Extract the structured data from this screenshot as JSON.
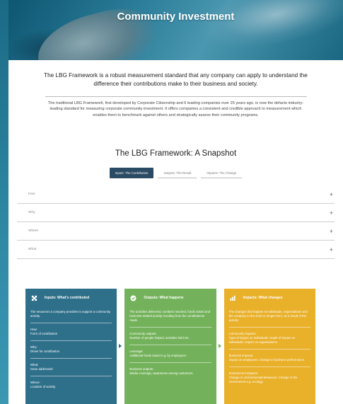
{
  "hero": {
    "title": "Community Investment"
  },
  "intro": {
    "lead": "The LBG Framework is a robust measurement standard that any company can apply to understand the difference their contributions make to their business and society.",
    "body": "The traditional LBG Framework, first developed by Corporate Citizenship and 6 leading companies over 25 years ago, is now the defacto industry-leading standard for measuring corporate community investment. It offers companies a consistent and credible approach to measurement which enables them to benchmark against others and strategically assess their community programs."
  },
  "snapshot": {
    "title": "The LBG Framework: A Snapshot",
    "tabs": [
      {
        "label": "Inputs: The Contribution",
        "active": true
      },
      {
        "label": "Outputs: The Result",
        "active": false
      },
      {
        "label": "Impacts: The Change",
        "active": false
      }
    ],
    "accordion": [
      {
        "label": "How",
        "icon": "plus-icon"
      },
      {
        "label": "Why",
        "icon": "plus-icon"
      },
      {
        "label": "Where",
        "icon": "plus-icon"
      },
      {
        "label": "What",
        "icon": "plus-icon"
      }
    ]
  },
  "cards": [
    {
      "title": "Inputs: What's contributed",
      "icon": "puzzle-icon",
      "color": "#2e6f8a",
      "desc": "The resources a company provides to support a community activity.",
      "items": [
        {
          "head": "How:",
          "text": "Form of contribution"
        },
        {
          "head": "Why:",
          "text": "Driver for contribution"
        },
        {
          "head": "What:",
          "text": "Issue addressed"
        },
        {
          "head": "Where:",
          "text": "Location of activity"
        }
      ]
    },
    {
      "title": "Outputs: What happens",
      "icon": "check-icon",
      "color": "#73b25a",
      "desc": "The activities delivered, numbers reached, funds raised and business-related activity resulting from the contributions made.",
      "items": [
        {
          "head": "Community outputs:",
          "text": "Number of people helped, activities held etc."
        },
        {
          "head": "Leverage:",
          "text": "Additional funds raised e.g. by employees."
        },
        {
          "head": "Business outputs:",
          "text": "Media coverage, awareness among customers."
        }
      ]
    },
    {
      "title": "Impacts: What changes",
      "icon": "chart-icon",
      "color": "#e9b02a",
      "desc": "The changes that happen to individuals, organisations and the company in the short or longer-term, as a result of the activity.",
      "items": [
        {
          "head": "Community impacts:",
          "text": "Type of impact on individuals. Depth of impact on individuals. Impact on organisations."
        },
        {
          "head": "Business impacts:",
          "text": "Impact on employees. Change in business performance."
        },
        {
          "head": "Environment impacts:",
          "text": "Change in environmental behaviour. Change in the environment e.g. ecology."
        }
      ]
    }
  ]
}
